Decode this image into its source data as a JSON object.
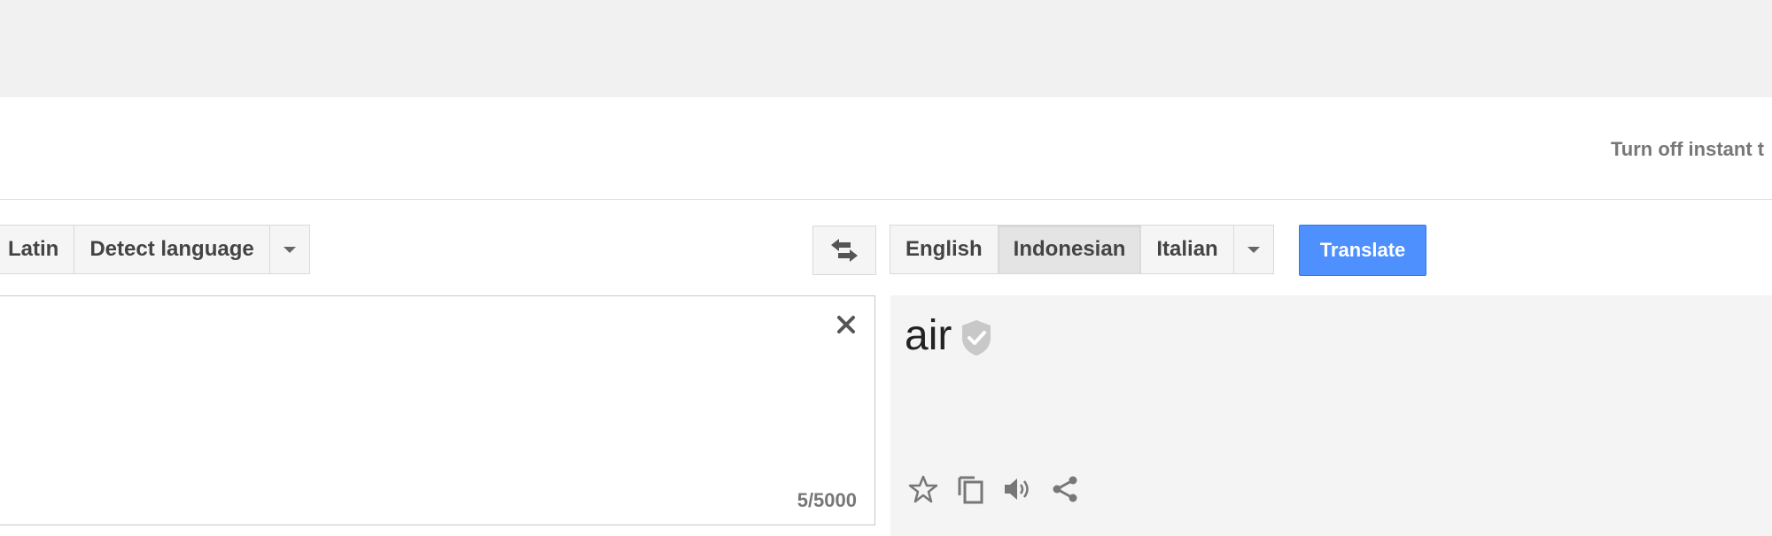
{
  "header": {
    "instant_link": "Turn off instant t"
  },
  "source": {
    "languages": [
      "Latin",
      "Detect language"
    ],
    "char_count": "5/5000",
    "text": ""
  },
  "target": {
    "languages": [
      "English",
      "Indonesian",
      "Italian"
    ],
    "selected": "Indonesian",
    "result": "air"
  },
  "actions": {
    "translate_label": "Translate"
  },
  "colors": {
    "accent": "#4d90fe",
    "result_bg": "#f4f4f4",
    "topbar_bg": "#f1f1f1"
  },
  "icons": [
    "swap-icon",
    "close-icon",
    "verified-shield-icon",
    "star-icon",
    "copy-icon",
    "speaker-icon",
    "share-icon",
    "chevron-down-icon"
  ]
}
